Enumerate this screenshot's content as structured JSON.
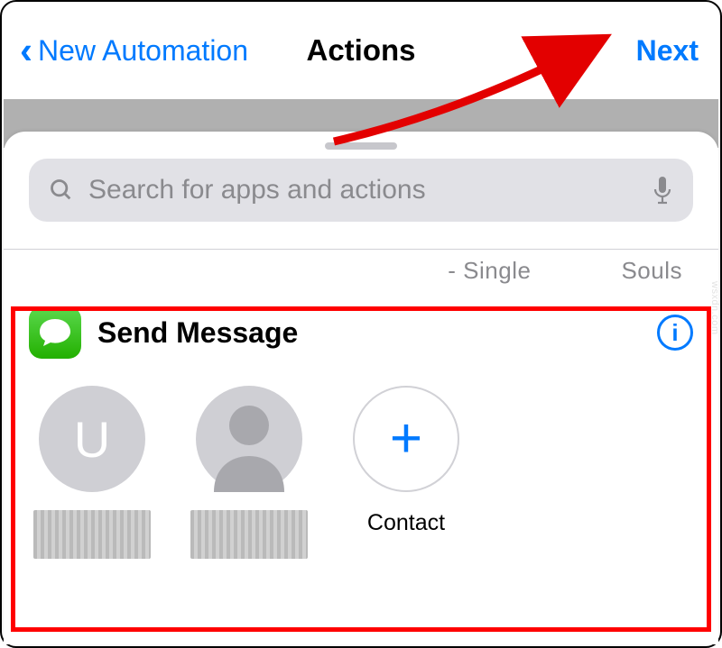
{
  "nav": {
    "back_label": "New Automation",
    "title": "Actions",
    "next_label": "Next"
  },
  "search": {
    "placeholder": "Search for apps and actions"
  },
  "peek": {
    "left": "- Single",
    "right": "Souls"
  },
  "action": {
    "title": "Send Message",
    "contacts": [
      {
        "avatar_type": "initial",
        "initial": "U"
      },
      {
        "avatar_type": "generic"
      }
    ],
    "add_label": "Contact",
    "info_symbol": "i"
  },
  "watermark": "wsxdn.com"
}
